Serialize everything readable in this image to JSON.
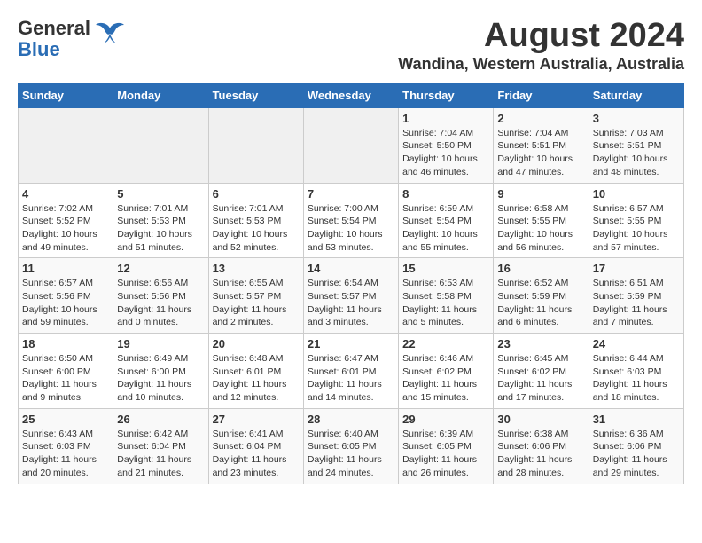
{
  "header": {
    "logo_general": "General",
    "logo_blue": "Blue",
    "title": "August 2024",
    "subtitle": "Wandina, Western Australia, Australia"
  },
  "calendar": {
    "days_of_week": [
      "Sunday",
      "Monday",
      "Tuesday",
      "Wednesday",
      "Thursday",
      "Friday",
      "Saturday"
    ],
    "weeks": [
      [
        {
          "day": "",
          "detail": ""
        },
        {
          "day": "",
          "detail": ""
        },
        {
          "day": "",
          "detail": ""
        },
        {
          "day": "",
          "detail": ""
        },
        {
          "day": "1",
          "detail": "Sunrise: 7:04 AM\nSunset: 5:50 PM\nDaylight: 10 hours\nand 46 minutes."
        },
        {
          "day": "2",
          "detail": "Sunrise: 7:04 AM\nSunset: 5:51 PM\nDaylight: 10 hours\nand 47 minutes."
        },
        {
          "day": "3",
          "detail": "Sunrise: 7:03 AM\nSunset: 5:51 PM\nDaylight: 10 hours\nand 48 minutes."
        }
      ],
      [
        {
          "day": "4",
          "detail": "Sunrise: 7:02 AM\nSunset: 5:52 PM\nDaylight: 10 hours\nand 49 minutes."
        },
        {
          "day": "5",
          "detail": "Sunrise: 7:01 AM\nSunset: 5:53 PM\nDaylight: 10 hours\nand 51 minutes."
        },
        {
          "day": "6",
          "detail": "Sunrise: 7:01 AM\nSunset: 5:53 PM\nDaylight: 10 hours\nand 52 minutes."
        },
        {
          "day": "7",
          "detail": "Sunrise: 7:00 AM\nSunset: 5:54 PM\nDaylight: 10 hours\nand 53 minutes."
        },
        {
          "day": "8",
          "detail": "Sunrise: 6:59 AM\nSunset: 5:54 PM\nDaylight: 10 hours\nand 55 minutes."
        },
        {
          "day": "9",
          "detail": "Sunrise: 6:58 AM\nSunset: 5:55 PM\nDaylight: 10 hours\nand 56 minutes."
        },
        {
          "day": "10",
          "detail": "Sunrise: 6:57 AM\nSunset: 5:55 PM\nDaylight: 10 hours\nand 57 minutes."
        }
      ],
      [
        {
          "day": "11",
          "detail": "Sunrise: 6:57 AM\nSunset: 5:56 PM\nDaylight: 10 hours\nand 59 minutes."
        },
        {
          "day": "12",
          "detail": "Sunrise: 6:56 AM\nSunset: 5:56 PM\nDaylight: 11 hours\nand 0 minutes."
        },
        {
          "day": "13",
          "detail": "Sunrise: 6:55 AM\nSunset: 5:57 PM\nDaylight: 11 hours\nand 2 minutes."
        },
        {
          "day": "14",
          "detail": "Sunrise: 6:54 AM\nSunset: 5:57 PM\nDaylight: 11 hours\nand 3 minutes."
        },
        {
          "day": "15",
          "detail": "Sunrise: 6:53 AM\nSunset: 5:58 PM\nDaylight: 11 hours\nand 5 minutes."
        },
        {
          "day": "16",
          "detail": "Sunrise: 6:52 AM\nSunset: 5:59 PM\nDaylight: 11 hours\nand 6 minutes."
        },
        {
          "day": "17",
          "detail": "Sunrise: 6:51 AM\nSunset: 5:59 PM\nDaylight: 11 hours\nand 7 minutes."
        }
      ],
      [
        {
          "day": "18",
          "detail": "Sunrise: 6:50 AM\nSunset: 6:00 PM\nDaylight: 11 hours\nand 9 minutes."
        },
        {
          "day": "19",
          "detail": "Sunrise: 6:49 AM\nSunset: 6:00 PM\nDaylight: 11 hours\nand 10 minutes."
        },
        {
          "day": "20",
          "detail": "Sunrise: 6:48 AM\nSunset: 6:01 PM\nDaylight: 11 hours\nand 12 minutes."
        },
        {
          "day": "21",
          "detail": "Sunrise: 6:47 AM\nSunset: 6:01 PM\nDaylight: 11 hours\nand 14 minutes."
        },
        {
          "day": "22",
          "detail": "Sunrise: 6:46 AM\nSunset: 6:02 PM\nDaylight: 11 hours\nand 15 minutes."
        },
        {
          "day": "23",
          "detail": "Sunrise: 6:45 AM\nSunset: 6:02 PM\nDaylight: 11 hours\nand 17 minutes."
        },
        {
          "day": "24",
          "detail": "Sunrise: 6:44 AM\nSunset: 6:03 PM\nDaylight: 11 hours\nand 18 minutes."
        }
      ],
      [
        {
          "day": "25",
          "detail": "Sunrise: 6:43 AM\nSunset: 6:03 PM\nDaylight: 11 hours\nand 20 minutes."
        },
        {
          "day": "26",
          "detail": "Sunrise: 6:42 AM\nSunset: 6:04 PM\nDaylight: 11 hours\nand 21 minutes."
        },
        {
          "day": "27",
          "detail": "Sunrise: 6:41 AM\nSunset: 6:04 PM\nDaylight: 11 hours\nand 23 minutes."
        },
        {
          "day": "28",
          "detail": "Sunrise: 6:40 AM\nSunset: 6:05 PM\nDaylight: 11 hours\nand 24 minutes."
        },
        {
          "day": "29",
          "detail": "Sunrise: 6:39 AM\nSunset: 6:05 PM\nDaylight: 11 hours\nand 26 minutes."
        },
        {
          "day": "30",
          "detail": "Sunrise: 6:38 AM\nSunset: 6:06 PM\nDaylight: 11 hours\nand 28 minutes."
        },
        {
          "day": "31",
          "detail": "Sunrise: 6:36 AM\nSunset: 6:06 PM\nDaylight: 11 hours\nand 29 minutes."
        }
      ]
    ]
  }
}
